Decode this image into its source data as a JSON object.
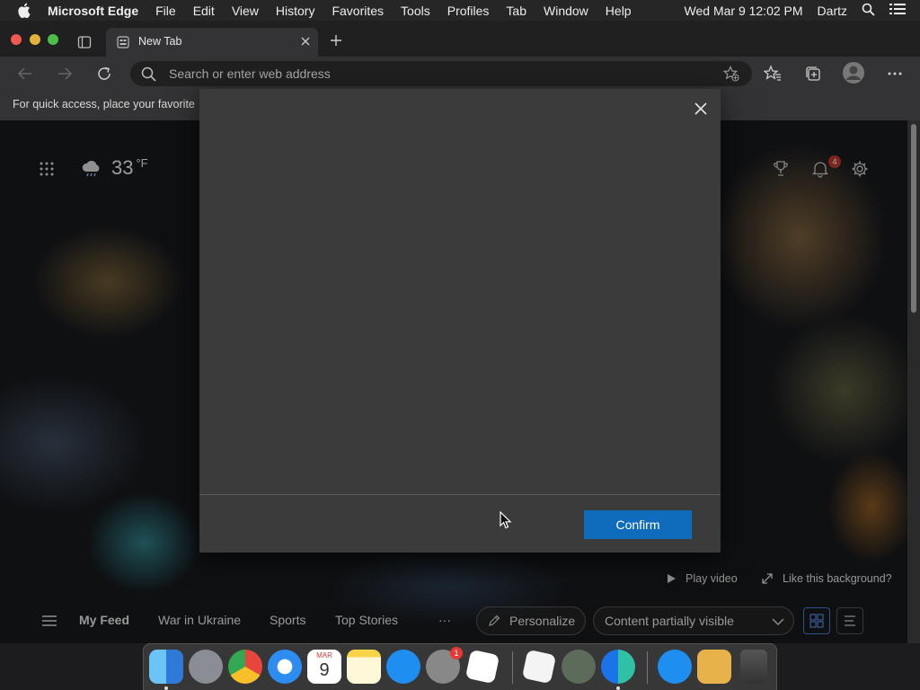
{
  "menubar": {
    "app_name": "Microsoft Edge",
    "menus": [
      "File",
      "Edit",
      "View",
      "History",
      "Favorites",
      "Tools",
      "Profiles",
      "Tab",
      "Window",
      "Help"
    ],
    "datetime": "Wed Mar 9  12:02 PM",
    "user": "Dartz"
  },
  "tab": {
    "title": "New Tab"
  },
  "address_bar": {
    "placeholder": "Search or enter web address"
  },
  "favorites_bar": {
    "text": "For quick access, place your favorite"
  },
  "weather": {
    "temp": "33",
    "unit": "°F",
    "icon": "cloudy-rain-icon"
  },
  "notifications": {
    "count": "4"
  },
  "background": {
    "play_label": "Play video",
    "like_label": "Like this background?"
  },
  "feed": {
    "items": [
      "My Feed",
      "War in Ukraine",
      "Sports",
      "Top Stories"
    ],
    "more": "···",
    "personalize": "Personalize",
    "content_select": "Content partially visible"
  },
  "modal": {
    "confirm_label": "Confirm"
  },
  "dock": {
    "apps": [
      "Finder",
      "Launchpad",
      "Google Chrome",
      "Safari",
      "Calendar",
      "Notes",
      "App Store",
      "System Preferences",
      "Roblox",
      "Roblox Player",
      "Automator",
      "Microsoft Edge",
      "App Store",
      "Archive Utility",
      "Trash"
    ],
    "calendar_month": "MAR",
    "calendar_day": "9",
    "prefs_badge": "1"
  },
  "colors": {
    "accent": "#0f6cbd",
    "badge": "#c0392b"
  }
}
